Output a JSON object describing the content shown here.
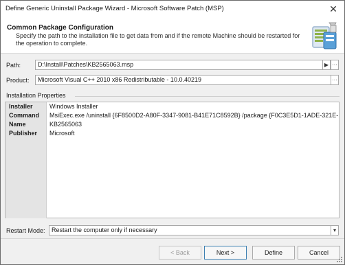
{
  "window": {
    "title": "Define Generic Uninstall Package Wizard - Microsoft Software Patch (MSP)",
    "close_glyph": "✕"
  },
  "header": {
    "title": "Common Package Configuration",
    "description": "Specify the path to the installation file to get data from and if the remote Machine should be restarted for the operation to complete."
  },
  "path": {
    "label": "Path:",
    "value": "D:\\Install\\Patches\\KB2565063.msp",
    "play_glyph": "▶",
    "browse_glyph": "···"
  },
  "product": {
    "label": "Product:",
    "value": "Microsoft Visual C++ 2010  x86 Redistributable - 10.0.40219",
    "browse_glyph": "···"
  },
  "installation_properties": {
    "title": "Installation Properties",
    "rows": [
      {
        "key": "Installer",
        "value": "Windows Installer"
      },
      {
        "key": "Command",
        "value": "MsiExec.exe /uninstall {6F8500D2-A80F-3347-9081-B41E71C8592B} /package {F0C3E5D1-1ADE-321E-8..."
      },
      {
        "key": "Name",
        "value": "KB2565063"
      },
      {
        "key": "Publisher",
        "value": "Microsoft"
      }
    ]
  },
  "restart": {
    "label": "Restart Mode:",
    "value": "Restart the computer only if necessary",
    "dropdown_glyph": "▾"
  },
  "buttons": {
    "back": "< Back",
    "next": "Next >",
    "define": "Define",
    "cancel": "Cancel"
  },
  "colors": {
    "accent": "#3c7fb1",
    "panel": "#f0f0f0",
    "key_column": "#e4e4e4"
  }
}
